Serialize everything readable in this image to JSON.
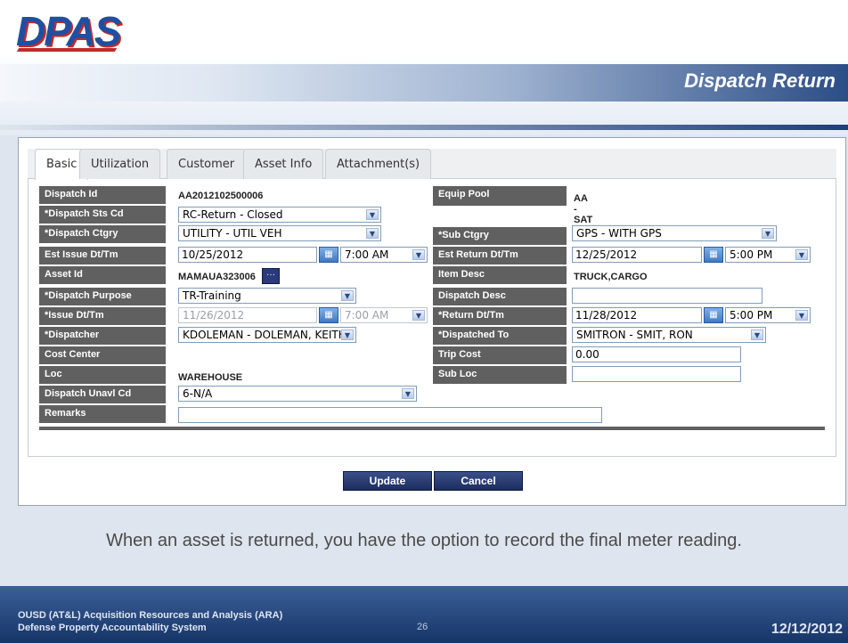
{
  "slide": {
    "logo_text": "DPAS",
    "title": "Dispatch Return",
    "caption": "When an asset is returned, you have the option to record the final meter reading.",
    "footer_line1": "OUSD (AT&L) Acquisition Resources and Analysis (ARA)",
    "footer_line2": "Defense Property Accountability System",
    "page_number": "26",
    "date": "12/12/2012"
  },
  "tabs": [
    "Basic",
    "Utilization",
    "Customer",
    "Asset Info",
    "Attachment(s)"
  ],
  "active_tab": "Basic",
  "form": {
    "dispatch_id": {
      "label": "Dispatch Id",
      "value": "AA2012102500006"
    },
    "equip_pool": {
      "label": "Equip Pool",
      "value": "AA - SAT"
    },
    "dispatch_sts_cd": {
      "label": "*Dispatch Sts Cd",
      "value": "RC-Return - Closed"
    },
    "dispatch_ctgry": {
      "label": "*Dispatch Ctgry",
      "value": "UTILITY - UTIL VEH"
    },
    "sub_ctgry": {
      "label": "*Sub Ctgry",
      "value": "GPS - WITH GPS"
    },
    "est_issue": {
      "label": "Est Issue Dt/Tm",
      "date": "10/25/2012",
      "time": "7:00 AM"
    },
    "est_return": {
      "label": "Est Return Dt/Tm",
      "date": "12/25/2012",
      "time": "5:00 PM"
    },
    "asset_id": {
      "label": "Asset Id",
      "value": "MAMAUA323006"
    },
    "item_desc": {
      "label": "Item Desc",
      "value": "TRUCK,CARGO"
    },
    "dispatch_purpose": {
      "label": "*Dispatch Purpose",
      "value": "TR-Training"
    },
    "dispatch_desc": {
      "label": "Dispatch Desc",
      "value": ""
    },
    "issue": {
      "label": "*Issue Dt/Tm",
      "date": "11/26/2012",
      "time": "7:00 AM"
    },
    "return": {
      "label": "*Return Dt/Tm",
      "date": "11/28/2012",
      "time": "5:00 PM"
    },
    "dispatcher": {
      "label": "*Dispatcher",
      "value": "KDOLEMAN - DOLEMAN, KEITH"
    },
    "dispatched_to": {
      "label": "*Dispatched To",
      "value": "SMITRON - SMIT, RON"
    },
    "cost_center": {
      "label": "Cost Center",
      "value": ""
    },
    "trip_cost": {
      "label": "Trip Cost",
      "value": "0.00"
    },
    "loc": {
      "label": "Loc",
      "value": "WAREHOUSE"
    },
    "sub_loc": {
      "label": "Sub Loc",
      "value": ""
    },
    "dispatch_unavl_cd": {
      "label": "Dispatch Unavl Cd",
      "value": "6-N/A"
    },
    "remarks": {
      "label": "Remarks",
      "value": ""
    }
  },
  "buttons": {
    "update": "Update",
    "cancel": "Cancel"
  },
  "icons": {
    "calendar": "calendar-icon",
    "dropdown": "chevron-down-icon",
    "lookup": "ellipsis-icon"
  }
}
